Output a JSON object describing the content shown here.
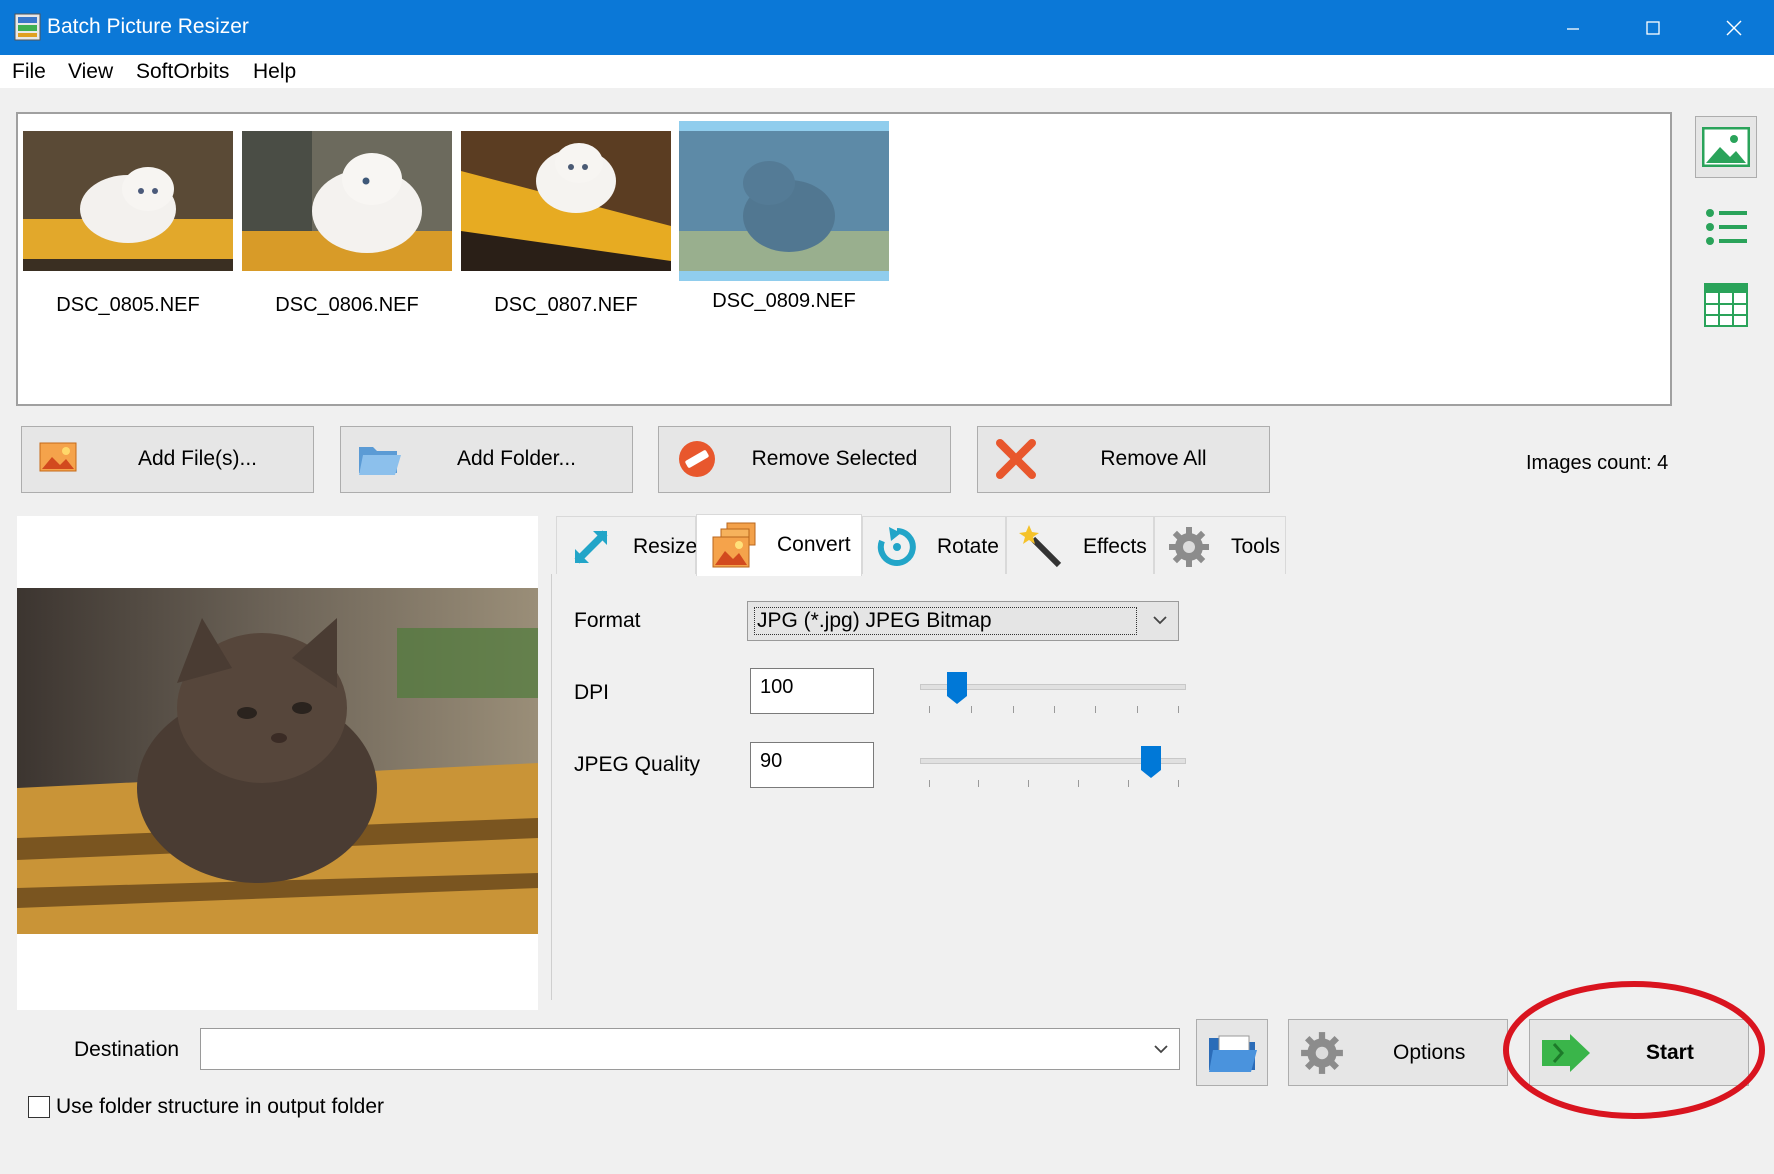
{
  "window": {
    "title": "Batch Picture Resizer",
    "controls": [
      "minimize",
      "maximize",
      "close"
    ]
  },
  "menu": {
    "items": [
      "File",
      "View",
      "SoftOrbits",
      "Help"
    ]
  },
  "thumbnails": [
    {
      "label": "DSC_0805.NEF",
      "selected": false
    },
    {
      "label": "DSC_0806.NEF",
      "selected": false
    },
    {
      "label": "DSC_0807.NEF",
      "selected": false
    },
    {
      "label": "DSC_0809.NEF",
      "selected": true
    }
  ],
  "side_view_buttons": [
    {
      "icon": "picture-view-icon"
    },
    {
      "icon": "list-view-icon"
    },
    {
      "icon": "grid-view-icon"
    }
  ],
  "actions": {
    "add_files": "Add File(s)...",
    "add_folder": "Add Folder...",
    "remove_selected": "Remove Selected",
    "remove_all": "Remove All"
  },
  "images_count": "Images count: 4",
  "tabs": [
    {
      "label": "Resize",
      "icon": "resize-icon",
      "active": false
    },
    {
      "label": "Convert",
      "icon": "convert-icon",
      "active": true
    },
    {
      "label": "Rotate",
      "icon": "rotate-icon",
      "active": false
    },
    {
      "label": "Effects",
      "icon": "magic-wand-icon",
      "active": false
    },
    {
      "label": "Tools",
      "icon": "gear-icon",
      "active": false
    }
  ],
  "convert": {
    "format_label": "Format",
    "format_value": "JPG (*.jpg) JPEG Bitmap",
    "dpi_label": "DPI",
    "dpi_value": "100",
    "quality_label": "JPEG Quality",
    "quality_value": "90"
  },
  "bottom": {
    "destination_label": "Destination",
    "destination_value": "",
    "options_label": "Options",
    "start_label": "Start",
    "folder_structure_label": "Use folder structure in output folder",
    "folder_structure_checked": false
  },
  "colors": {
    "titlebar": "#0b78d7",
    "highlight_circle": "#d9141f",
    "accent": "#0078d7"
  }
}
